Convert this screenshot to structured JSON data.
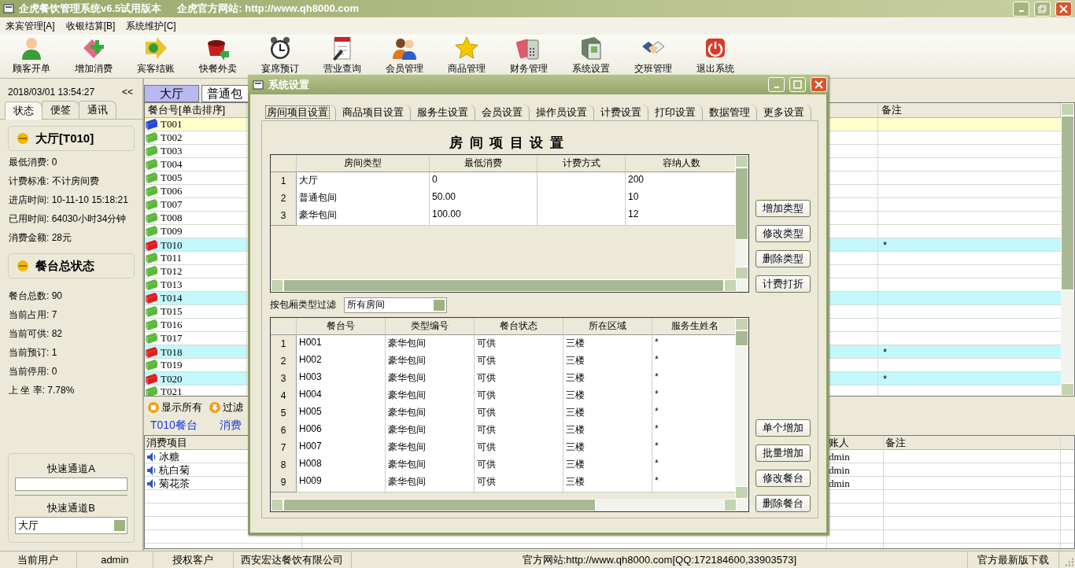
{
  "window": {
    "title": "企虎餐饮管理系统v6.5试用版本",
    "website": "企虎官方网站: http://www.qh8000.com"
  },
  "menu": [
    "来宾管理[A]",
    "收银结算[B]",
    "系统维护[C]"
  ],
  "toolbar": [
    {
      "label": "顾客开单"
    },
    {
      "label": "增加消费"
    },
    {
      "label": "宾客结账"
    },
    {
      "label": "快餐外卖"
    },
    {
      "label": "宴席预订"
    },
    {
      "label": "营业查询"
    },
    {
      "label": "会员管理"
    },
    {
      "label": "商品管理"
    },
    {
      "label": "财务管理"
    },
    {
      "label": "系统设置"
    },
    {
      "label": "交班管理"
    },
    {
      "label": "退出系统"
    }
  ],
  "left_panel": {
    "datetime": "2018/03/01 13:54:27",
    "collapse": "<<",
    "tabs": [
      {
        "label": "状态",
        "selected": true
      },
      {
        "label": "便签",
        "selected": false
      },
      {
        "label": "通讯",
        "selected": false
      }
    ],
    "current_table": {
      "title": "大厅[T010]",
      "lines": [
        "最低消费: 0",
        "计费标准: 不计房间费",
        "进店时间: 10-11-10 15:18:21",
        "已用时间: 64030小时34分钟",
        "消费金额: 28元"
      ]
    },
    "summary": {
      "title": "餐台总状态",
      "lines": [
        "餐台总数: 90",
        "当前占用: 7",
        "当前可供: 82",
        "当前预订: 1",
        "当前停用: 0",
        "上 坐 率: 7.78%"
      ]
    },
    "quick_a": {
      "label": "快速通道A"
    },
    "quick_b": {
      "label": "快速通道B",
      "value": "大厅"
    }
  },
  "area_tabs": [
    {
      "label": "大厅",
      "selected": true
    },
    {
      "label": "普通包",
      "selected": false
    }
  ],
  "main_table": {
    "columns": [
      "餐台号[单击排序]",
      "备注"
    ],
    "rows": [
      {
        "id": "T001",
        "kind": "reserved"
      },
      {
        "id": "T002",
        "kind": "free"
      },
      {
        "id": "T003",
        "kind": "free"
      },
      {
        "id": "T004",
        "kind": "free"
      },
      {
        "id": "T005",
        "kind": "free"
      },
      {
        "id": "T006",
        "kind": "free"
      },
      {
        "id": "T007",
        "kind": "free"
      },
      {
        "id": "T008",
        "kind": "free"
      },
      {
        "id": "T009",
        "kind": "free"
      },
      {
        "id": "T010",
        "kind": "occupied",
        "note": "*"
      },
      {
        "id": "T011",
        "kind": "free"
      },
      {
        "id": "T012",
        "kind": "free"
      },
      {
        "id": "T013",
        "kind": "free"
      },
      {
        "id": "T014",
        "kind": "occupied"
      },
      {
        "id": "T015",
        "kind": "free"
      },
      {
        "id": "T016",
        "kind": "free"
      },
      {
        "id": "T017",
        "kind": "free"
      },
      {
        "id": "T018",
        "kind": "occupied",
        "note": "*"
      },
      {
        "id": "T019",
        "kind": "free"
      },
      {
        "id": "T020",
        "kind": "occupied",
        "note": "*"
      },
      {
        "id": "T021",
        "kind": "free"
      }
    ]
  },
  "filter_buttons": [
    {
      "label": "显示所有"
    },
    {
      "label": "过滤"
    }
  ],
  "links": [
    "T010餐台",
    "消费"
  ],
  "order_table": {
    "columns": [
      "消费项目",
      "账人",
      "备注"
    ],
    "rows": [
      {
        "item": "冰糖",
        "operator": "dmin"
      },
      {
        "item": "杭白菊",
        "operator": "dmin"
      },
      {
        "item": "菊花茶",
        "operator": "dmin"
      }
    ]
  },
  "status_bar": [
    "当前用户",
    "admin",
    "授权客户",
    "西安宏达餐饮有限公司",
    "官方网站:http://www.qh8000.com[QQ:172184600,33903573]",
    "官方最新版下载"
  ],
  "dialog": {
    "title": "系统设置",
    "tabs": [
      {
        "label": "房间项目设置",
        "selected": true
      },
      {
        "label": "商品项目设置",
        "selected": false
      },
      {
        "label": "服务生设置",
        "selected": false
      },
      {
        "label": "会员设置",
        "selected": false
      },
      {
        "label": "操作员设置",
        "selected": false
      },
      {
        "label": "计费设置",
        "selected": false
      },
      {
        "label": "打印设置",
        "selected": false
      },
      {
        "label": "数据管理",
        "selected": false
      },
      {
        "label": "更多设置",
        "selected": false
      }
    ],
    "heading": "房间项目设置",
    "room_types": {
      "columns": [
        "房间类型",
        "最低消费",
        "计费方式",
        "容纳人数"
      ],
      "rows": [
        {
          "no": "1",
          "type": "大厅",
          "min": "0",
          "capacity": "200"
        },
        {
          "no": "2",
          "type": "普通包间",
          "min": "50.00",
          "capacity": "10"
        },
        {
          "no": "3",
          "type": "豪华包间",
          "min": "100.00",
          "capacity": "12"
        }
      ]
    },
    "type_buttons": [
      "增加类型",
      "修改类型",
      "删除类型",
      "计费打折"
    ],
    "filter": {
      "label": "按包厢类型过滤",
      "value": "所有房间"
    },
    "tables": {
      "columns": [
        "餐台号",
        "类型编号",
        "餐台状态",
        "所在区域",
        "服务生姓名"
      ],
      "rows": [
        {
          "no": "1",
          "id": "H001",
          "type": "豪华包间",
          "state": "可供",
          "area": "三楼",
          "waiter": "*"
        },
        {
          "no": "2",
          "id": "H002",
          "type": "豪华包间",
          "state": "可供",
          "area": "三楼",
          "waiter": "*"
        },
        {
          "no": "3",
          "id": "H003",
          "type": "豪华包间",
          "state": "可供",
          "area": "三楼",
          "waiter": "*"
        },
        {
          "no": "4",
          "id": "H004",
          "type": "豪华包间",
          "state": "可供",
          "area": "三楼",
          "waiter": "*"
        },
        {
          "no": "5",
          "id": "H005",
          "type": "豪华包间",
          "state": "可供",
          "area": "三楼",
          "waiter": "*"
        },
        {
          "no": "6",
          "id": "H006",
          "type": "豪华包间",
          "state": "可供",
          "area": "三楼",
          "waiter": "*"
        },
        {
          "no": "7",
          "id": "H007",
          "type": "豪华包间",
          "state": "可供",
          "area": "三楼",
          "waiter": "*"
        },
        {
          "no": "8",
          "id": "H008",
          "type": "豪华包间",
          "state": "可供",
          "area": "三楼",
          "waiter": "*"
        },
        {
          "no": "9",
          "id": "H009",
          "type": "豪华包间",
          "state": "可供",
          "area": "三楼",
          "waiter": "*"
        }
      ]
    },
    "table_buttons": [
      "单个增加",
      "批量增加",
      "修改餐台",
      "删除餐台"
    ]
  }
}
